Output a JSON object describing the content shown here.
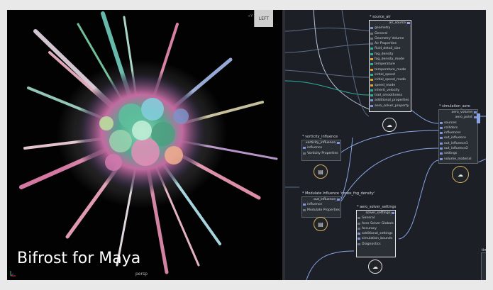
{
  "viewport": {
    "brand": "Bifrost for Maya",
    "camera_label": "persp",
    "viewcube_label": "LEFT",
    "axis_tag": "+Y"
  },
  "nodes": {
    "source_air": {
      "title": "* source_air",
      "header": "air_source",
      "rows": [
        "geometry",
        "General",
        "Geometry Volume",
        "Air Properties",
        "fluid_detail_size",
        "fog_density",
        "fog_density_mode",
        "temperature",
        "temperature_mode",
        "initial_speed",
        "initial_speed_mode",
        "speed_mode",
        "inherit_velocity",
        "trail_smoothness",
        "additional_properties",
        "aero_solver_property"
      ]
    },
    "simulation_aero": {
      "title": "* simulation_aero",
      "rows_out": [
        "aero_volume",
        "aero_point"
      ],
      "rows_in": [
        "sources",
        "colliders",
        "influences",
        "out_influence",
        "out_influence1",
        "out_influence2",
        "settings",
        "volume_material"
      ]
    },
    "vorticity_influence": {
      "title": "* vorticity_influence",
      "header": "vorticity_influence",
      "rows": [
        "influence",
        "Vorticity Properties"
      ]
    },
    "modulate_influence": {
      "title": "* Modulate Influence 'cones_fog_density'",
      "header": "out_influence",
      "rows": [
        "influence",
        "Modulate Properties"
      ]
    },
    "aero_solver_settings": {
      "title": "* aero_solver_settings",
      "header": "solver_settings",
      "rows": [
        "General",
        "Aero Solver Globals",
        "Accuracy",
        "additional_settings",
        "simulation_bounds",
        "Diagnostics"
      ]
    },
    "corner_stub": {
      "title": "time"
    }
  }
}
